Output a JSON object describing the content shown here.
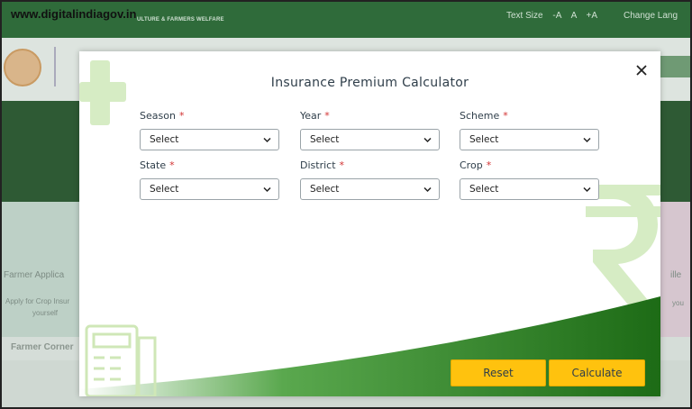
{
  "watermark": "www.digitalindiagov.in",
  "background": {
    "ministry_text": "ULTURE & FARMERS WELFARE",
    "text_size_label": "Text Size",
    "text_size_options": [
      "-A",
      "A",
      "+A"
    ],
    "change_language": "Change Lang",
    "card_left_title": "Farmer Applica",
    "card_left_sub": "Apply for Crop Insur",
    "card_left_sub2": "yourself",
    "card_right_title": "ille",
    "card_right_sub": "you",
    "bottom_bar_text": "Farmer Corner"
  },
  "modal": {
    "title": "Insurance Premium Calculator",
    "fields": {
      "season": {
        "label": "Season",
        "value": "Select"
      },
      "year": {
        "label": "Year",
        "value": "Select"
      },
      "scheme": {
        "label": "Scheme",
        "value": "Select"
      },
      "state": {
        "label": "State",
        "value": "Select"
      },
      "district": {
        "label": "District",
        "value": "Select"
      },
      "crop": {
        "label": "Crop",
        "value": "Select"
      }
    },
    "required_mark": "*",
    "reset_label": "Reset",
    "calculate_label": "Calculate"
  },
  "icons": {
    "close": "close-icon",
    "chevron": "chevron-down-icon",
    "plus": "plus-icon",
    "rupee": "rupee-icon",
    "calculator": "calculator-icon"
  },
  "colors": {
    "accent_green": "#1f7a1f",
    "button_yellow": "#ffc20e",
    "required_red": "#d23232",
    "title_text": "#2f3e4a"
  }
}
